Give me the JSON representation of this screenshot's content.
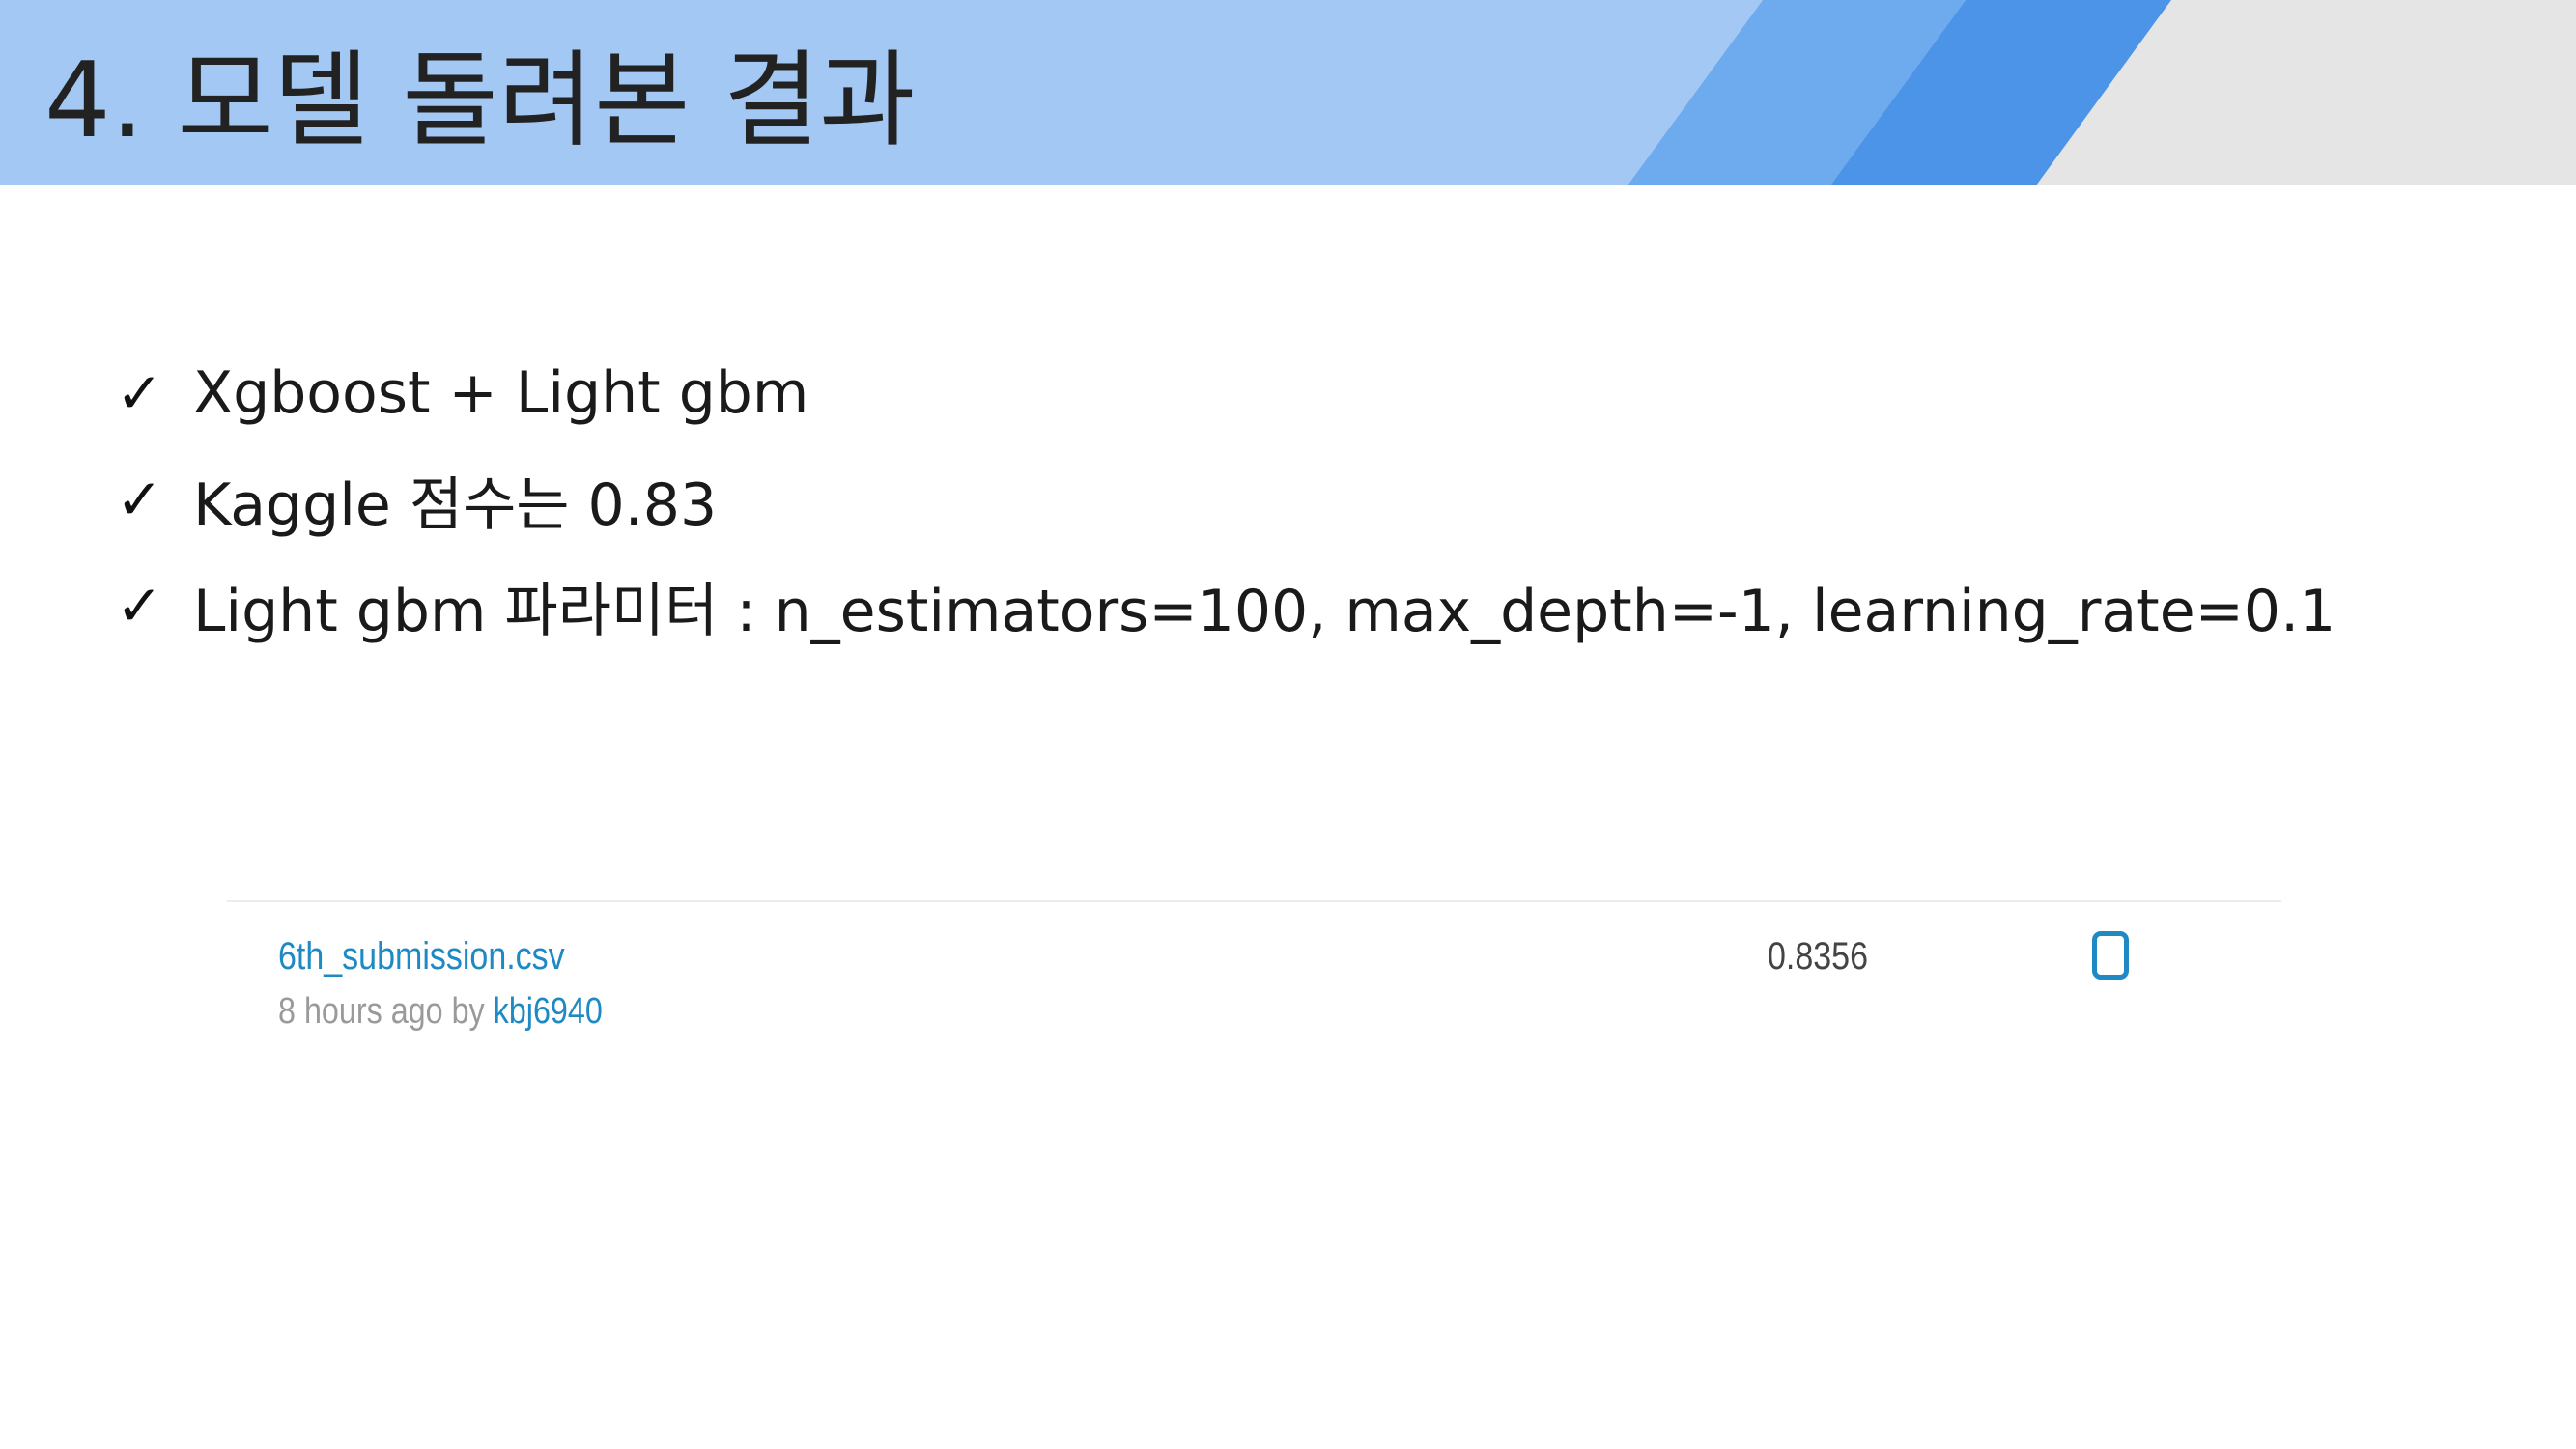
{
  "slide": {
    "title": "4. 모델 돌려본 결과"
  },
  "bullets": [
    {
      "icon": "check-icon",
      "glyph": "✓",
      "text": "Xgboost + Light gbm"
    },
    {
      "icon": "check-icon",
      "glyph": "✓",
      "text": "Kaggle 점수는 0.83"
    },
    {
      "icon": "check-icon",
      "glyph": "✓",
      "text": "Light gbm 파라미터 : n_estimators=100, max_depth=-1, learning_rate=0.1"
    }
  ],
  "submission": {
    "file_name": "6th_submission.csv",
    "time_text": "8 hours ago by ",
    "user": "kbj6940",
    "score": "0.8356",
    "selected": false
  },
  "colors": {
    "header_light": "#a3c8f3",
    "header_mid": "#6eaaee",
    "header_dark": "#4b94e8",
    "header_gray": "#e5e5e5",
    "link_blue": "#1f89c4"
  }
}
